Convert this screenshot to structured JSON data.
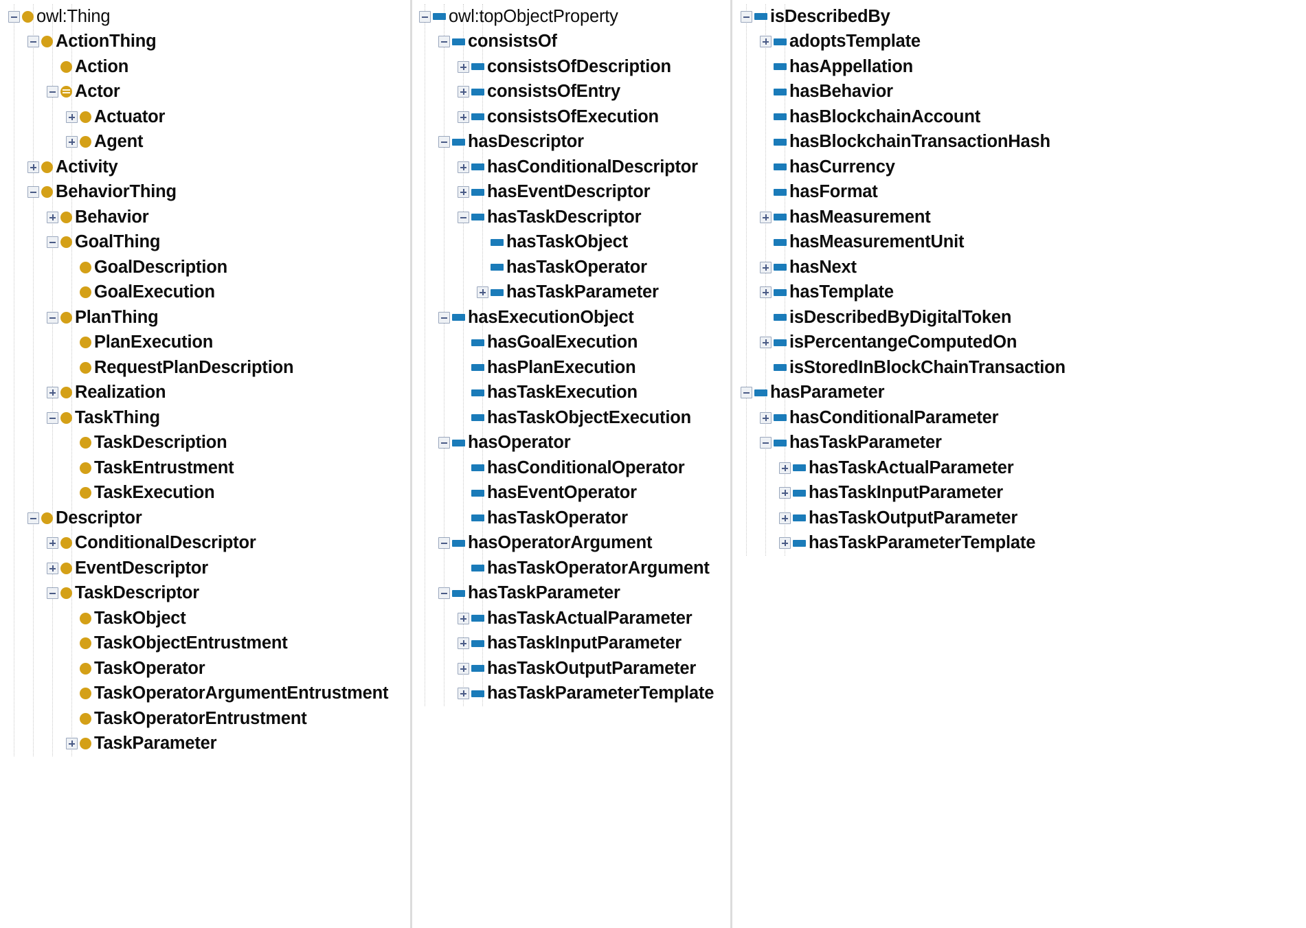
{
  "view": {
    "title": "Ontology Hierarchy Tree View",
    "colors": {
      "class_icon": "#d4a017",
      "object_property_icon": "#1a7bb9",
      "toggle_border": "#9aa7bd",
      "toggle_glyph": "#4a5b86",
      "text": "#0d0d0d",
      "background": "#ffffff",
      "divider": "#dcdcdc"
    },
    "icon_names": {
      "class": "class-circle-icon",
      "defined_class": "defined-class-circle-icon",
      "object_property": "object-property-bar-icon",
      "expanded": "collapse-minus-icon",
      "collapsed": "expand-plus-icon"
    }
  },
  "columns": [
    {
      "id": "class-hierarchy",
      "name": "class-hierarchy-panel",
      "nodes": [
        {
          "label": "owl:Thing",
          "depth": 0,
          "toggle": "minus",
          "icon": "class",
          "root": true
        },
        {
          "label": "ActionThing",
          "depth": 1,
          "toggle": "minus",
          "icon": "class"
        },
        {
          "label": "Action",
          "depth": 2,
          "toggle": "none",
          "icon": "class"
        },
        {
          "label": "Actor",
          "depth": 2,
          "toggle": "minus",
          "icon": "defined-class"
        },
        {
          "label": "Actuator",
          "depth": 3,
          "toggle": "plus",
          "icon": "class"
        },
        {
          "label": "Agent",
          "depth": 3,
          "toggle": "plus",
          "icon": "class"
        },
        {
          "label": "Activity",
          "depth": 1,
          "toggle": "plus",
          "icon": "class"
        },
        {
          "label": "BehaviorThing",
          "depth": 1,
          "toggle": "minus",
          "icon": "class"
        },
        {
          "label": "Behavior",
          "depth": 2,
          "toggle": "plus",
          "icon": "class"
        },
        {
          "label": "GoalThing",
          "depth": 2,
          "toggle": "minus",
          "icon": "class"
        },
        {
          "label": "GoalDescription",
          "depth": 3,
          "toggle": "none",
          "icon": "class"
        },
        {
          "label": "GoalExecution",
          "depth": 3,
          "toggle": "none",
          "icon": "class"
        },
        {
          "label": "PlanThing",
          "depth": 2,
          "toggle": "minus",
          "icon": "class"
        },
        {
          "label": "PlanExecution",
          "depth": 3,
          "toggle": "none",
          "icon": "class"
        },
        {
          "label": "RequestPlanDescription",
          "depth": 3,
          "toggle": "none",
          "icon": "class"
        },
        {
          "label": "Realization",
          "depth": 2,
          "toggle": "plus",
          "icon": "class"
        },
        {
          "label": "TaskThing",
          "depth": 2,
          "toggle": "minus",
          "icon": "class"
        },
        {
          "label": "TaskDescription",
          "depth": 3,
          "toggle": "none",
          "icon": "class"
        },
        {
          "label": "TaskEntrustment",
          "depth": 3,
          "toggle": "none",
          "icon": "class"
        },
        {
          "label": "TaskExecution",
          "depth": 3,
          "toggle": "none",
          "icon": "class"
        },
        {
          "label": "Descriptor",
          "depth": 1,
          "toggle": "minus",
          "icon": "class"
        },
        {
          "label": "ConditionalDescriptor",
          "depth": 2,
          "toggle": "plus",
          "icon": "class"
        },
        {
          "label": "EventDescriptor",
          "depth": 2,
          "toggle": "plus",
          "icon": "class"
        },
        {
          "label": "TaskDescriptor",
          "depth": 2,
          "toggle": "minus",
          "icon": "class"
        },
        {
          "label": "TaskObject",
          "depth": 3,
          "toggle": "none",
          "icon": "class"
        },
        {
          "label": "TaskObjectEntrustment",
          "depth": 3,
          "toggle": "none",
          "icon": "class"
        },
        {
          "label": "TaskOperator",
          "depth": 3,
          "toggle": "none",
          "icon": "class"
        },
        {
          "label": "TaskOperatorArgumentEntrustment",
          "depth": 3,
          "toggle": "none",
          "icon": "class"
        },
        {
          "label": "TaskOperatorEntrustment",
          "depth": 3,
          "toggle": "none",
          "icon": "class"
        },
        {
          "label": "TaskParameter",
          "depth": 3,
          "toggle": "plus",
          "icon": "class"
        }
      ]
    },
    {
      "id": "object-property-hierarchy",
      "name": "object-property-hierarchy-panel",
      "nodes": [
        {
          "label": "owl:topObjectProperty",
          "depth": 0,
          "toggle": "minus",
          "icon": "object-property",
          "root": true
        },
        {
          "label": "consistsOf",
          "depth": 1,
          "toggle": "minus",
          "icon": "object-property"
        },
        {
          "label": "consistsOfDescription",
          "depth": 2,
          "toggle": "plus",
          "icon": "object-property"
        },
        {
          "label": "consistsOfEntry",
          "depth": 2,
          "toggle": "plus",
          "icon": "object-property"
        },
        {
          "label": "consistsOfExecution",
          "depth": 2,
          "toggle": "plus",
          "icon": "object-property"
        },
        {
          "label": "hasDescriptor",
          "depth": 1,
          "toggle": "minus",
          "icon": "object-property"
        },
        {
          "label": "hasConditionalDescriptor",
          "depth": 2,
          "toggle": "plus",
          "icon": "object-property"
        },
        {
          "label": "hasEventDescriptor",
          "depth": 2,
          "toggle": "plus",
          "icon": "object-property"
        },
        {
          "label": "hasTaskDescriptor",
          "depth": 2,
          "toggle": "minus",
          "icon": "object-property"
        },
        {
          "label": "hasTaskObject",
          "depth": 3,
          "toggle": "none",
          "icon": "object-property"
        },
        {
          "label": "hasTaskOperator",
          "depth": 3,
          "toggle": "none",
          "icon": "object-property"
        },
        {
          "label": "hasTaskParameter",
          "depth": 3,
          "toggle": "plus",
          "icon": "object-property"
        },
        {
          "label": "hasExecutionObject",
          "depth": 1,
          "toggle": "minus",
          "icon": "object-property"
        },
        {
          "label": "hasGoalExecution",
          "depth": 2,
          "toggle": "none",
          "icon": "object-property"
        },
        {
          "label": "hasPlanExecution",
          "depth": 2,
          "toggle": "none",
          "icon": "object-property"
        },
        {
          "label": "hasTaskExecution",
          "depth": 2,
          "toggle": "none",
          "icon": "object-property"
        },
        {
          "label": "hasTaskObjectExecution",
          "depth": 2,
          "toggle": "none",
          "icon": "object-property"
        },
        {
          "label": "hasOperator",
          "depth": 1,
          "toggle": "minus",
          "icon": "object-property"
        },
        {
          "label": "hasConditionalOperator",
          "depth": 2,
          "toggle": "none",
          "icon": "object-property"
        },
        {
          "label": "hasEventOperator",
          "depth": 2,
          "toggle": "none",
          "icon": "object-property"
        },
        {
          "label": "hasTaskOperator",
          "depth": 2,
          "toggle": "none",
          "icon": "object-property"
        },
        {
          "label": "hasOperatorArgument",
          "depth": 1,
          "toggle": "minus",
          "icon": "object-property"
        },
        {
          "label": "hasTaskOperatorArgument",
          "depth": 2,
          "toggle": "none",
          "icon": "object-property"
        },
        {
          "label": "hasTaskParameter",
          "depth": 1,
          "toggle": "minus",
          "icon": "object-property"
        },
        {
          "label": "hasTaskActualParameter",
          "depth": 2,
          "toggle": "plus",
          "icon": "object-property"
        },
        {
          "label": "hasTaskInputParameter",
          "depth": 2,
          "toggle": "plus",
          "icon": "object-property"
        },
        {
          "label": "hasTaskOutputParameter",
          "depth": 2,
          "toggle": "plus",
          "icon": "object-property"
        },
        {
          "label": "hasTaskParameterTemplate",
          "depth": 2,
          "toggle": "plus",
          "icon": "object-property"
        }
      ]
    },
    {
      "id": "object-property-hierarchy-continued",
      "name": "object-property-hierarchy-panel-continued",
      "nodes": [
        {
          "label": "isDescribedBy",
          "depth": 0,
          "toggle": "minus",
          "icon": "object-property"
        },
        {
          "label": "adoptsTemplate",
          "depth": 1,
          "toggle": "plus",
          "icon": "object-property"
        },
        {
          "label": "hasAppellation",
          "depth": 1,
          "toggle": "none",
          "icon": "object-property"
        },
        {
          "label": "hasBehavior",
          "depth": 1,
          "toggle": "none",
          "icon": "object-property"
        },
        {
          "label": "hasBlockchainAccount",
          "depth": 1,
          "toggle": "none",
          "icon": "object-property"
        },
        {
          "label": "hasBlockchainTransactionHash",
          "depth": 1,
          "toggle": "none",
          "icon": "object-property"
        },
        {
          "label": "hasCurrency",
          "depth": 1,
          "toggle": "none",
          "icon": "object-property"
        },
        {
          "label": "hasFormat",
          "depth": 1,
          "toggle": "none",
          "icon": "object-property"
        },
        {
          "label": "hasMeasurement",
          "depth": 1,
          "toggle": "plus",
          "icon": "object-property"
        },
        {
          "label": "hasMeasurementUnit",
          "depth": 1,
          "toggle": "none",
          "icon": "object-property"
        },
        {
          "label": "hasNext",
          "depth": 1,
          "toggle": "plus",
          "icon": "object-property"
        },
        {
          "label": "hasTemplate",
          "depth": 1,
          "toggle": "plus",
          "icon": "object-property"
        },
        {
          "label": "isDescribedByDigitalToken",
          "depth": 1,
          "toggle": "none",
          "icon": "object-property"
        },
        {
          "label": "isPercentangeComputedOn",
          "depth": 1,
          "toggle": "plus",
          "icon": "object-property"
        },
        {
          "label": "isStoredInBlockChainTransaction",
          "depth": 1,
          "toggle": "none",
          "icon": "object-property"
        },
        {
          "label": "hasParameter",
          "depth": 0,
          "toggle": "minus",
          "icon": "object-property"
        },
        {
          "label": "hasConditionalParameter",
          "depth": 1,
          "toggle": "plus",
          "icon": "object-property"
        },
        {
          "label": "hasTaskParameter",
          "depth": 1,
          "toggle": "minus",
          "icon": "object-property"
        },
        {
          "label": "hasTaskActualParameter",
          "depth": 2,
          "toggle": "plus",
          "icon": "object-property"
        },
        {
          "label": "hasTaskInputParameter",
          "depth": 2,
          "toggle": "plus",
          "icon": "object-property"
        },
        {
          "label": "hasTaskOutputParameter",
          "depth": 2,
          "toggle": "plus",
          "icon": "object-property"
        },
        {
          "label": "hasTaskParameterTemplate",
          "depth": 2,
          "toggle": "plus",
          "icon": "object-property"
        }
      ]
    }
  ]
}
